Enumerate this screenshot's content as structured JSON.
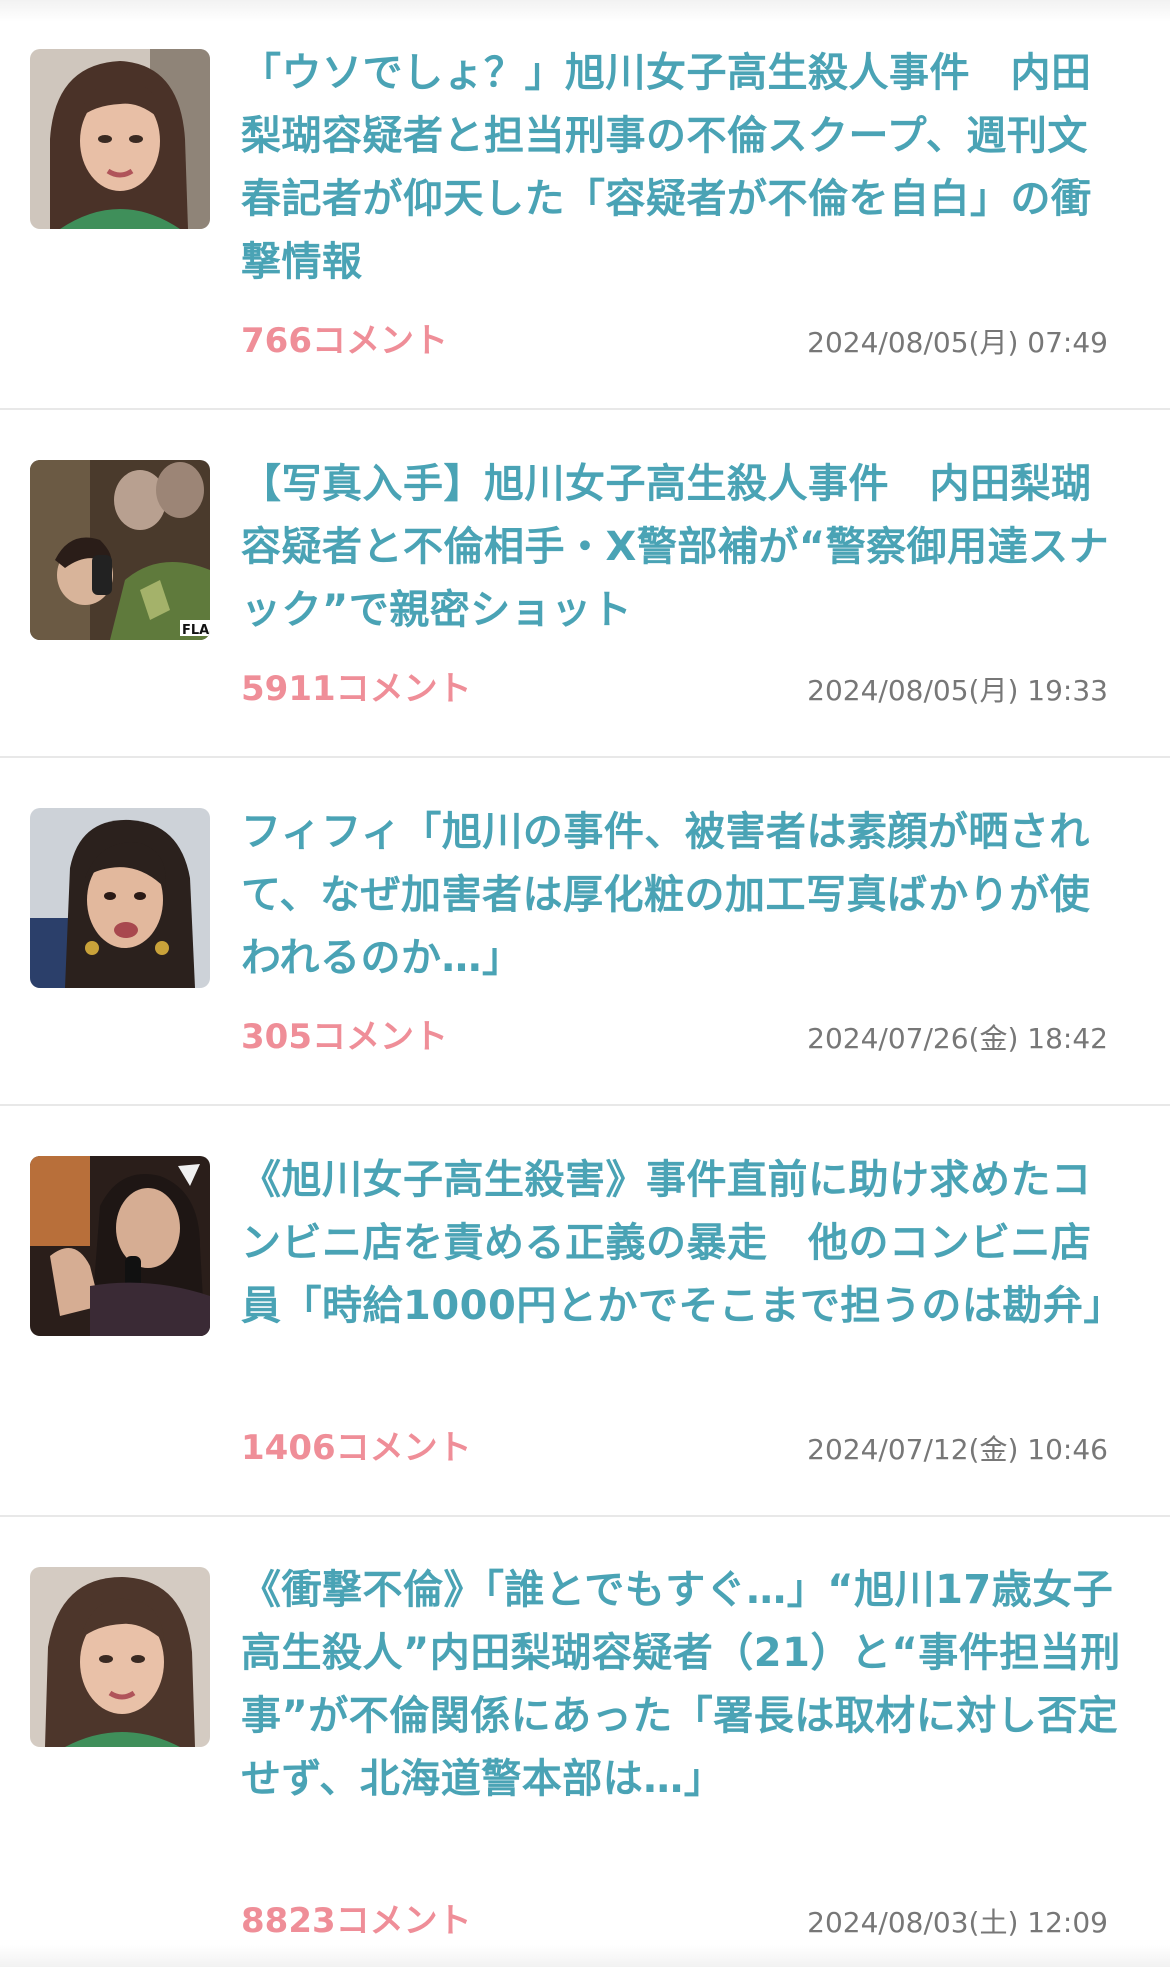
{
  "articles": [
    {
      "title": "「ウソでしょ？」旭川女子高生殺人事件　内田梨瑚容疑者と担当刑事の不倫スクープ、週刊文春記者が仰天した「容疑者が不倫を自白」の衝撃情報",
      "comments": "766コメント",
      "date": "2024/08/05(月) 07:49"
    },
    {
      "title": "【写真入手】旭川女子高生殺人事件　内田梨瑚容疑者と不倫相手・X警部補が“警察御用達スナック”で親密ショット",
      "comments": "5911コメント",
      "date": "2024/08/05(月) 19:33"
    },
    {
      "title": "フィフィ「旭川の事件、被害者は素顔が晒されて、なぜ加害者は厚化粧の加工写真ばかりが使われるのか…」",
      "comments": "305コメント",
      "date": "2024/07/26(金) 18:42"
    },
    {
      "title": "《旭川女子高生殺害》事件直前に助け求めたコンビニ店を責める正義の暴走　他のコンビニ店員「時給1000円とかでそこまで担うのは勘弁」",
      "comments": "1406コメント",
      "date": "2024/07/12(金) 10:46"
    },
    {
      "title": "《衝撃不倫》「誰とでもすぐ…」“旭川17歳女子高生殺人”内田梨瑚容疑者（21）と“事件担当刑事”が不倫関係にあった「署長は取材に対し否定せず、北海道警本部は…」",
      "comments": "8823コメント",
      "date": "2024/08/03(土) 12:09"
    }
  ]
}
